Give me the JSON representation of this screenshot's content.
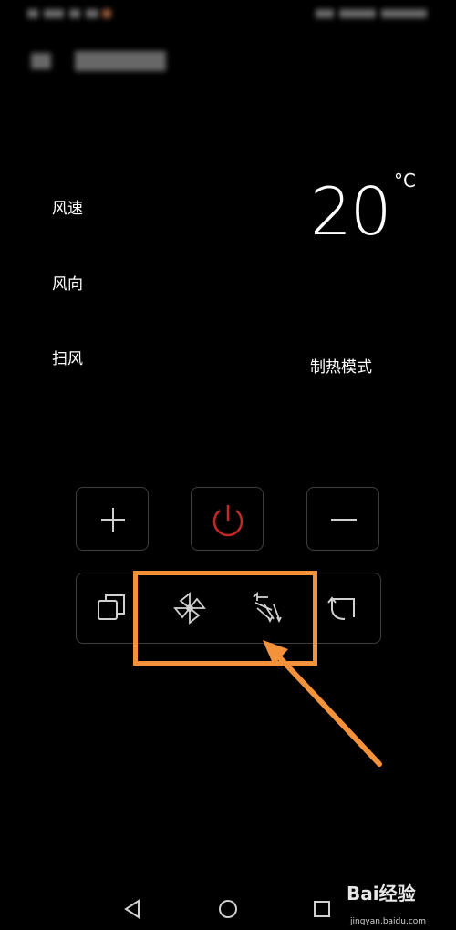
{
  "controls": {
    "wind_speed_label": "风速",
    "wind_direction_label": "风向",
    "swing_label": "扫风"
  },
  "display": {
    "temperature": "20",
    "unit": "°C",
    "mode": "制热模式"
  },
  "buttons": {
    "plus": "plus-icon",
    "power": "power-icon",
    "minus": "minus-icon",
    "mode": "mode-icon",
    "fan": "fan-icon",
    "swing": "swing-icon",
    "rotate": "rotate-icon"
  },
  "colors": {
    "power": "#c62828",
    "highlight": "#f4913b",
    "border": "#3e3e3e"
  },
  "watermark": {
    "brand": "Bai经验",
    "url": "jingyan.baidu.com"
  }
}
